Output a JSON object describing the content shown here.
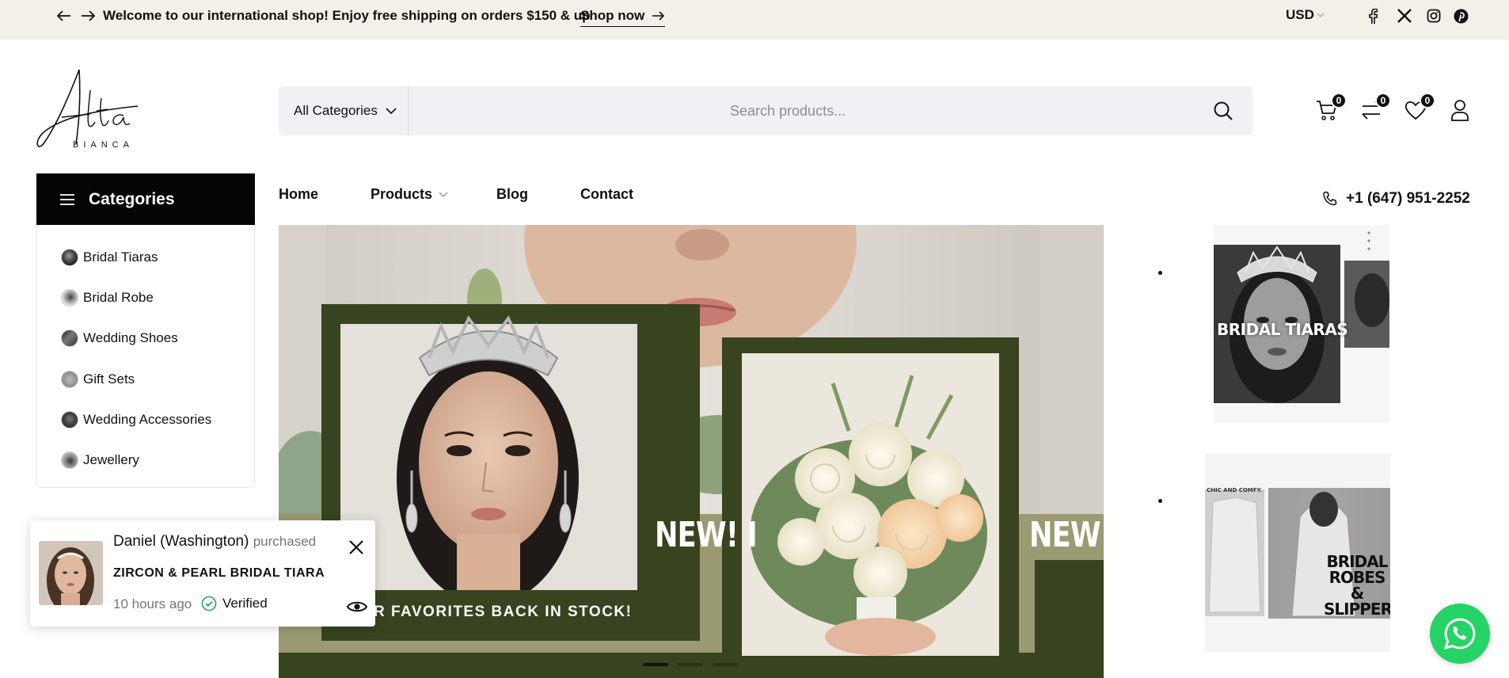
{
  "announcement": {
    "message": "Welcome to our international shop! Enjoy free shipping on orders $150 & up",
    "cta": "Shop now"
  },
  "currency": "USD",
  "social": [
    "facebook-icon",
    "x-icon",
    "instagram-icon",
    "pinterest-icon"
  ],
  "logo": {
    "main": "Alta",
    "sub": "BIANCA"
  },
  "search": {
    "category": "All Categories",
    "placeholder": "Search products..."
  },
  "header_icons": {
    "cart_count": "0",
    "compare_count": "0",
    "wishlist_count": "0"
  },
  "categories": {
    "title": "Categories",
    "items": [
      {
        "label": "Bridal Tiaras"
      },
      {
        "label": "Bridal Robe"
      },
      {
        "label": "Wedding Shoes"
      },
      {
        "label": "Gift Sets"
      },
      {
        "label": "Wedding Accessories"
      },
      {
        "label": "Jewellery"
      }
    ]
  },
  "nav": {
    "home": "Home",
    "products": "Products",
    "blog": "Blog",
    "contact": "Contact"
  },
  "phone": "+1 (647) 951-2252",
  "hero": {
    "new_text_1": "NEW! I",
    "new_text_2": "NEW! N",
    "favorites_text": "R FAVORITES BACK IN STOCK!",
    "slides": 3,
    "active_slide": 1
  },
  "promos": {
    "tiaras_label": "BRIDAL TIARAS",
    "robes_tag": "CHIC AND COMFY.",
    "robes_line1": "BRIDAL",
    "robes_line2": "ROBES",
    "robes_line3": "&",
    "robes_line4": "SLIPPERS"
  },
  "notification": {
    "customer": "Daniel (Washington)",
    "action": "purchased",
    "product": "ZIRCON & PEARL BRIDAL TIARA",
    "time": "10 hours ago",
    "status": "Verified"
  },
  "colors": {
    "topbar_bg": "#f3efe9",
    "category_header_bg": "#050505",
    "hero_dark_green": "#38431f",
    "hero_olive": "#9a9a73",
    "whatsapp": "#25d366",
    "verified": "#2aa85a"
  }
}
